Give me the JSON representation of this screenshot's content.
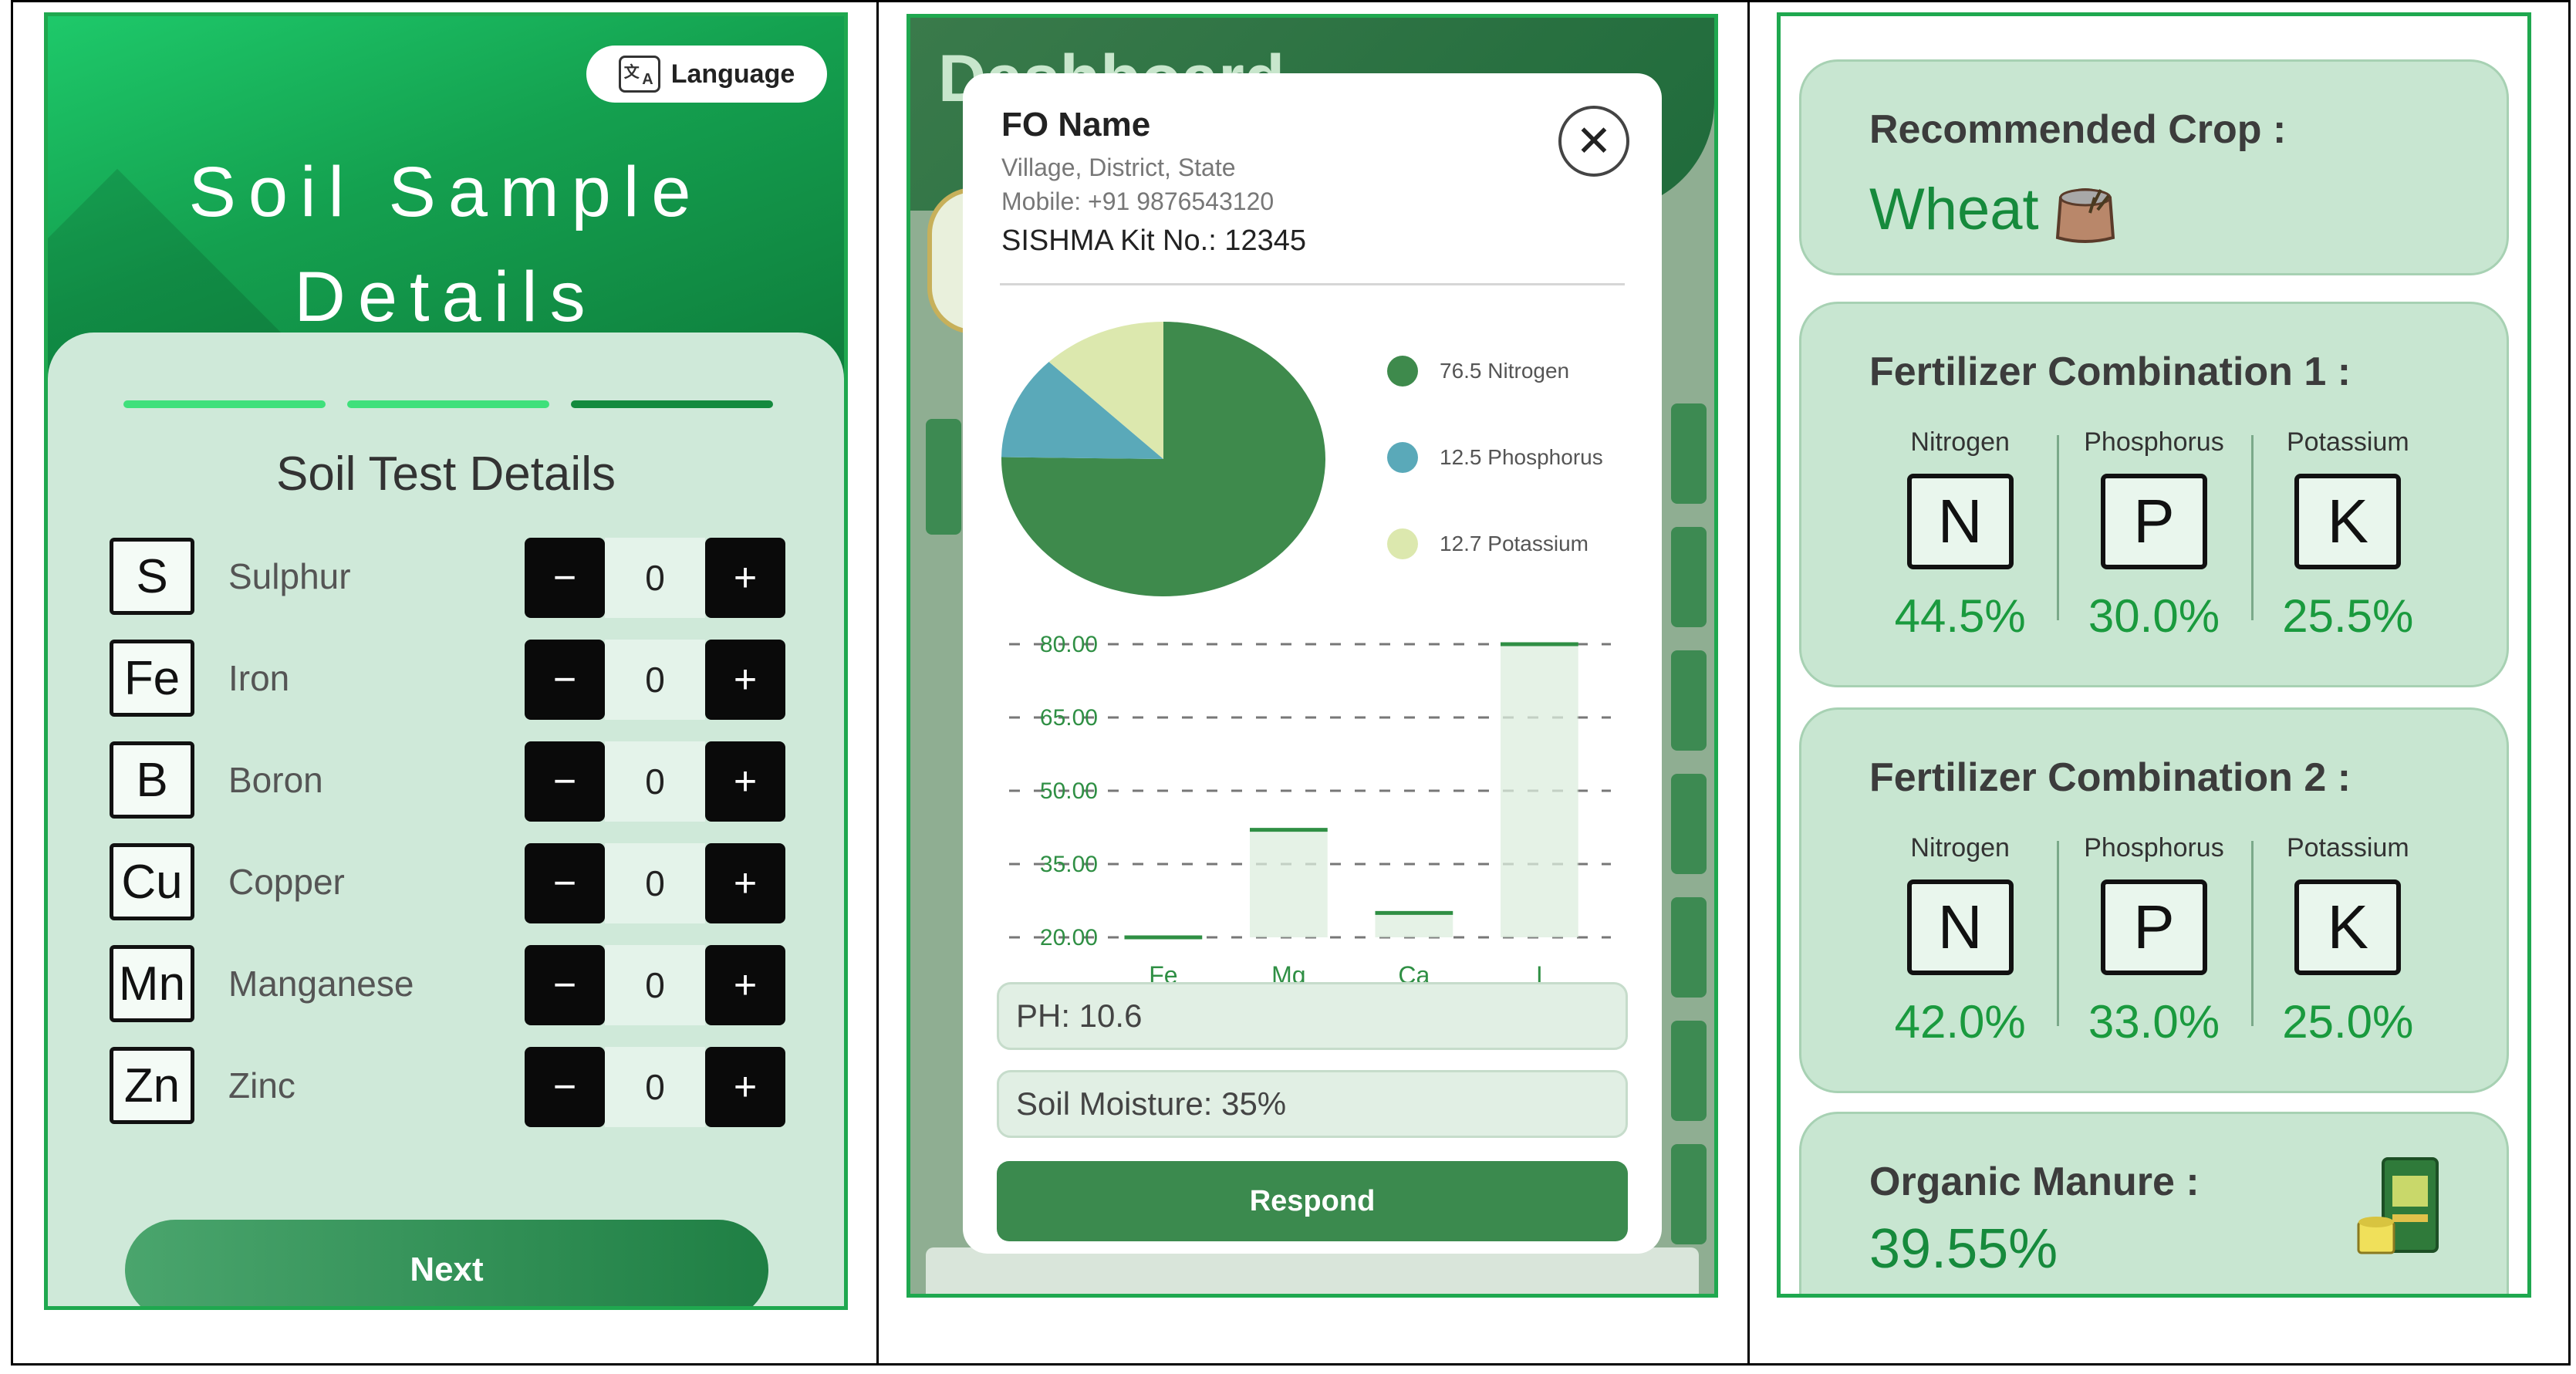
{
  "panel1": {
    "language_label": "Language",
    "title_line1": "Soil Sample",
    "title_line2": "Details",
    "subtitle": "Soil Test Details",
    "elements": [
      {
        "symbol": "S",
        "name": "Sulphur",
        "value": "0"
      },
      {
        "symbol": "Fe",
        "name": "Iron",
        "value": "0"
      },
      {
        "symbol": "B",
        "name": "Boron",
        "value": "0"
      },
      {
        "symbol": "Cu",
        "name": "Copper",
        "value": "0"
      },
      {
        "symbol": "Mn",
        "name": "Manganese",
        "value": "0"
      },
      {
        "symbol": "Zn",
        "name": "Zinc",
        "value": "0"
      }
    ],
    "minus": "−",
    "plus": "+",
    "next_label": "Next",
    "progress_step_active": 3,
    "progress_steps": 3
  },
  "panel2": {
    "background_title": "Dashboard",
    "fo_name": "FO Name",
    "location": "Village, District, State",
    "mobile": "Mobile: +91 9876543120",
    "kit": "SISHMA Kit No.: 12345",
    "close_symbol": "✕",
    "ph": "PH: 10.6",
    "moisture": "Soil Moisture: 35%",
    "respond_label": "Respond",
    "colors": {
      "nitrogen": "#3e8a4c",
      "phosphorus": "#5aa9b9",
      "potassium": "#dce8ae",
      "accent": "#3b8a4e"
    }
  },
  "chart_data": [
    {
      "type": "pie",
      "categories": [
        "Nitrogen",
        "Phosphorus",
        "Potassium"
      ],
      "values": [
        76.5,
        12.5,
        12.7
      ],
      "legend_labels": [
        "76.5 Nitrogen",
        "12.5 Phosphorus",
        "12.7 Potassium"
      ],
      "colors": [
        "#3e8a4c",
        "#5aa9b9",
        "#dce8ae"
      ],
      "legend": "right"
    },
    {
      "type": "bar",
      "categories": [
        "Fe",
        "Mg",
        "Ca",
        "I"
      ],
      "values": [
        20,
        42,
        25,
        80
      ],
      "ylim": [
        20,
        80
      ],
      "yticks": [
        "20.00",
        "35.00",
        "50.00",
        "65.00",
        "80.00"
      ],
      "ytick_values": [
        20,
        35,
        50,
        65,
        80
      ],
      "grid": true,
      "color": "#2f8f44"
    }
  ],
  "panel3": {
    "recommended_title": "Recommended Crop :",
    "recommended_crop": "Wheat",
    "combos": [
      {
        "title": "Fertilizer Combination 1 :",
        "items": [
          {
            "label": "Nitrogen",
            "symbol": "N",
            "pct": "44.5%"
          },
          {
            "label": "Phosphorus",
            "symbol": "P",
            "pct": "30.0%"
          },
          {
            "label": "Potassium",
            "symbol": "K",
            "pct": "25.5%"
          }
        ]
      },
      {
        "title": "Fertilizer Combination 2 :",
        "items": [
          {
            "label": "Nitrogen",
            "symbol": "N",
            "pct": "42.0%"
          },
          {
            "label": "Phosphorus",
            "symbol": "P",
            "pct": "33.0%"
          },
          {
            "label": "Potassium",
            "symbol": "K",
            "pct": "25.0%"
          }
        ]
      }
    ],
    "manure_title": "Organic Manure :",
    "manure_value": "39.55%"
  }
}
